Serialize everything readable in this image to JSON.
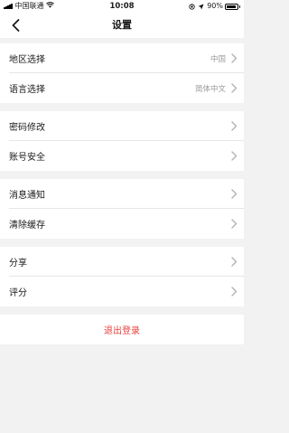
{
  "status_bar": {
    "carrier": "中国联通",
    "time": "10:08",
    "battery": "90%",
    "battery_level": 0.9
  },
  "nav": {
    "title": "设置",
    "back_icon": "chevron-left-icon"
  },
  "groups": [
    [
      {
        "label": "地区选择",
        "value": "中国"
      },
      {
        "label": "语言选择",
        "value": "简体中文"
      }
    ],
    [
      {
        "label": "密码修改",
        "value": ""
      },
      {
        "label": "账号安全",
        "value": ""
      }
    ],
    [
      {
        "label": "消息通知",
        "value": ""
      },
      {
        "label": "清除缓存",
        "value": ""
      }
    ],
    [
      {
        "label": "分享",
        "value": ""
      },
      {
        "label": "评分",
        "value": ""
      }
    ]
  ],
  "logout": {
    "label": "退出登录"
  },
  "colors": {
    "accent_red": "#e8423c",
    "background": "#f2f2f2",
    "secondary_text": "#999999"
  }
}
